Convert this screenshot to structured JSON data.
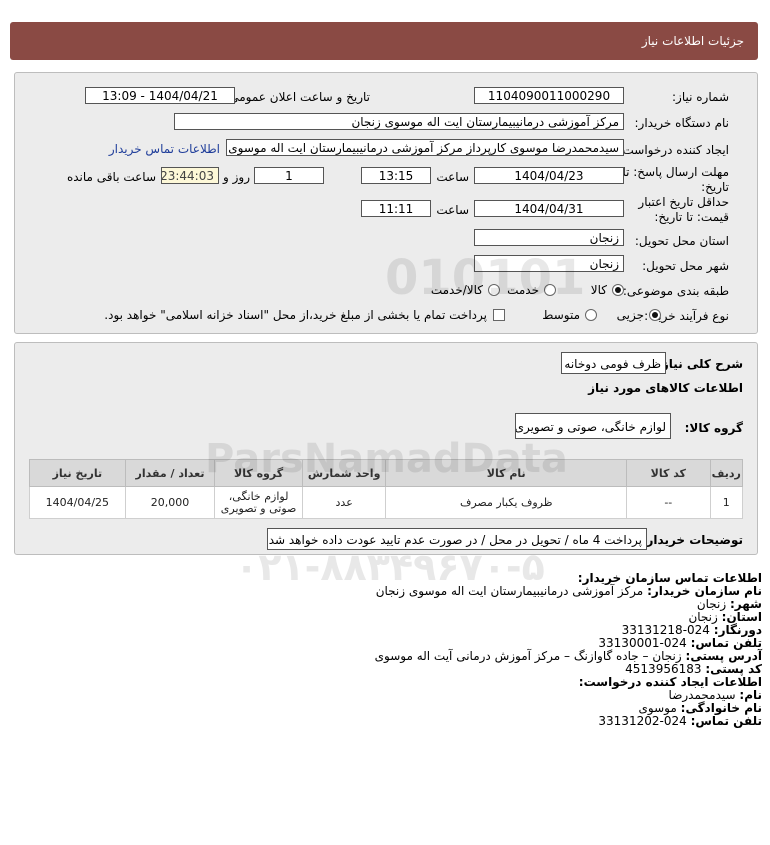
{
  "header": {
    "title": "جزئیات اطلاعات نیاز"
  },
  "form": {
    "need_number_label": "شماره نیاز:",
    "need_number": "1104090011000290",
    "announce_label": "تاریخ و ساعت اعلان عمومی:",
    "announce_value": "1404/04/21 - 13:09",
    "buyer_label": "نام دستگاه خریدار:",
    "buyer_value": "مرکز آموزشی درمانیبیمارستان ایت اله موسوی زنجان",
    "creator_label": "ایجاد کننده درخواست:",
    "creator_value": "سیدمحمدرضا موسوی کارپرداز مرکز آموزشی درمانیبیمارستان ایت اله موسوی زنجان",
    "contact_link": "اطلاعات تماس خریدار",
    "deadline_label_1": "مهلت ارسال پاسخ: تا",
    "deadline_label_2": "تاریخ:",
    "deadline_date": "1404/04/23",
    "time_label": "ساعت",
    "deadline_time": "13:15",
    "days_value": "1",
    "days_label": "روز و",
    "remaining_time": "23:44:03",
    "remaining_label": "ساعت باقی مانده",
    "validity_label_1": "حداقل تاریخ اعتبار",
    "validity_label_2": "قیمت: تا تاریخ:",
    "validity_date": "1404/04/31",
    "validity_time_label": "ساعت",
    "validity_time": "11:11",
    "province_label": "استان محل تحویل:",
    "province_value": "زنجان",
    "city_label": "شهر محل تحویل:",
    "city_value": "زنجان",
    "category_label": "طبقه بندی موضوعی:",
    "category_options": [
      "کالا",
      "خدمت",
      "کالا/خدمت"
    ],
    "category_selected": "کالا",
    "process_label": "نوع فرآیند خرید :",
    "process_options": [
      "جزیی",
      "متوسط"
    ],
    "process_selected": "جزیی",
    "payment_text": "پرداخت تمام یا بخشی از مبلغ خرید،از محل \"اسناد خزانه اسلامی\" خواهد بود."
  },
  "details": {
    "summary_label": "شرح کلی نیاز:",
    "summary_value": "ظرف فومی دوخانه",
    "goods_info_title": "اطلاعات کالاهای مورد نیاز",
    "goods_group_label": "گروه کالا:",
    "goods_group_value": "لوازم خانگی، صوتی و تصویری",
    "table": {
      "headers": [
        "ردیف",
        "کد کالا",
        "نام کالا",
        "واحد شمارش",
        "گروه کالا",
        "تعداد / مقدار",
        "تاریخ نیاز"
      ],
      "rows": [
        [
          "1",
          "--",
          "ظروف یکبار مصرف",
          "عدد",
          "لوازم خانگی، صوتی و تصویری",
          "20,000",
          "1404/04/25"
        ]
      ]
    },
    "buyer_notes_label": "توضیحات خریدار:",
    "buyer_notes_value": "پرداخت 4 ماه / تحویل در محل / در صورت عدم تایید عودت داده خواهد شد"
  },
  "contact": {
    "title": "اطلاعات تماس سازمان خریدار:",
    "org_label": "نام سازمان خریدار:",
    "org_value": "مرکز آموزشی درمانیبیمارستان ایت اله موسوی زنجان",
    "city_label": "شهر:",
    "city_value": "زنجان",
    "province_label": "استان:",
    "province_value": "زنجان",
    "fax_label": "دورنگار:",
    "fax_value": "024-33131218",
    "phone_label": "تلفن تماس:",
    "phone_value": "024-33130001",
    "address_label": "آدرس پستی:",
    "address_value": "زنجان – جاده گاوازنگ – مرکز آموزش درمانی آیت اله موسوی",
    "postal_label": "کد پستی:",
    "postal_value": "4513956183",
    "creator_title": "اطلاعات ایجاد کننده درخواست:",
    "name_label": "نام:",
    "name_value": "سیدمحمدرضا",
    "family_label": "نام خانوادگی:",
    "family_value": "موسوی",
    "creator_phone_label": "تلفن تماس:",
    "creator_phone_value": "024-33131202"
  },
  "watermark": {
    "brand": "ParsNamadData",
    "phone": "۰۲۱-۸۸۳۴۹۶۷۰-۵",
    "digits": "010101"
  }
}
